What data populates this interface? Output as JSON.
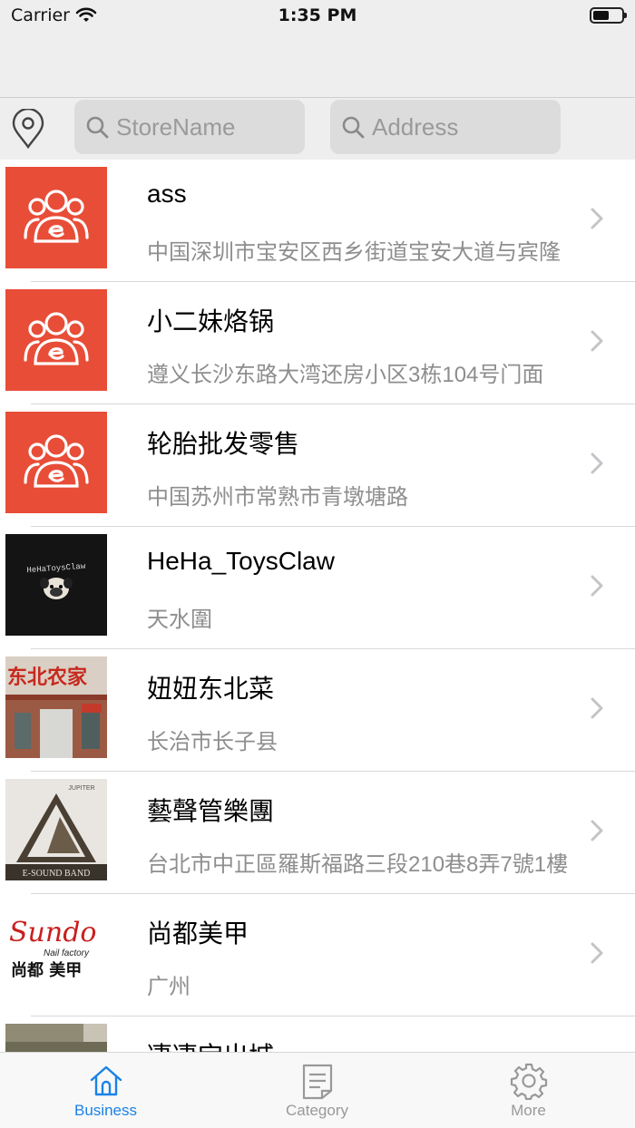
{
  "status_bar": {
    "carrier": "Carrier",
    "time": "1:35 PM",
    "battery_level": 0.55
  },
  "search": {
    "store_placeholder": "StoreName",
    "address_placeholder": "Address"
  },
  "stores": [
    {
      "name": "ass",
      "address": "中国深圳市宝安区西乡街道宝安大道与宾隆",
      "thumb": "default-logo"
    },
    {
      "name": "小二妹烙锅",
      "address": "遵义长沙东路大湾还房小区3栋104号门面",
      "thumb": "default-logo"
    },
    {
      "name": "轮胎批发零售",
      "address": "中国苏州市常熟市青墩塘路",
      "thumb": "default-logo"
    },
    {
      "name": "HeHa_ToysClaw",
      "address": "天水圍",
      "thumb": "pug-logo",
      "thumb_text": "HeHaToysClaw"
    },
    {
      "name": "妞妞东北菜",
      "address": "长治市长子县",
      "thumb": "storefront-photo",
      "thumb_text": "东北农家"
    },
    {
      "name": "藝聲管樂團",
      "address": "台北市中正區羅斯福路三段210巷8弄7號1樓",
      "thumb": "band-logo",
      "thumb_text": "E-SOUND BAND",
      "thumb_text2": "JUPITER"
    },
    {
      "name": "尚都美甲",
      "address": "广州",
      "thumb": "nail-logo",
      "thumb_text": "Sundo",
      "thumb_text2": "Nail factory",
      "thumb_text3": "尚都 美甲"
    },
    {
      "name": "凄凄宝出城",
      "address": "",
      "thumb": "photo-partial"
    }
  ],
  "tabs": [
    {
      "label": "Business",
      "icon": "home-icon",
      "active": true
    },
    {
      "label": "Category",
      "icon": "document-icon",
      "active": false
    },
    {
      "label": "More",
      "icon": "gear-icon",
      "active": false
    }
  ],
  "colors": {
    "brand_red": "#e84d38",
    "tab_active": "#1a82e6",
    "tab_inactive": "#999999"
  }
}
